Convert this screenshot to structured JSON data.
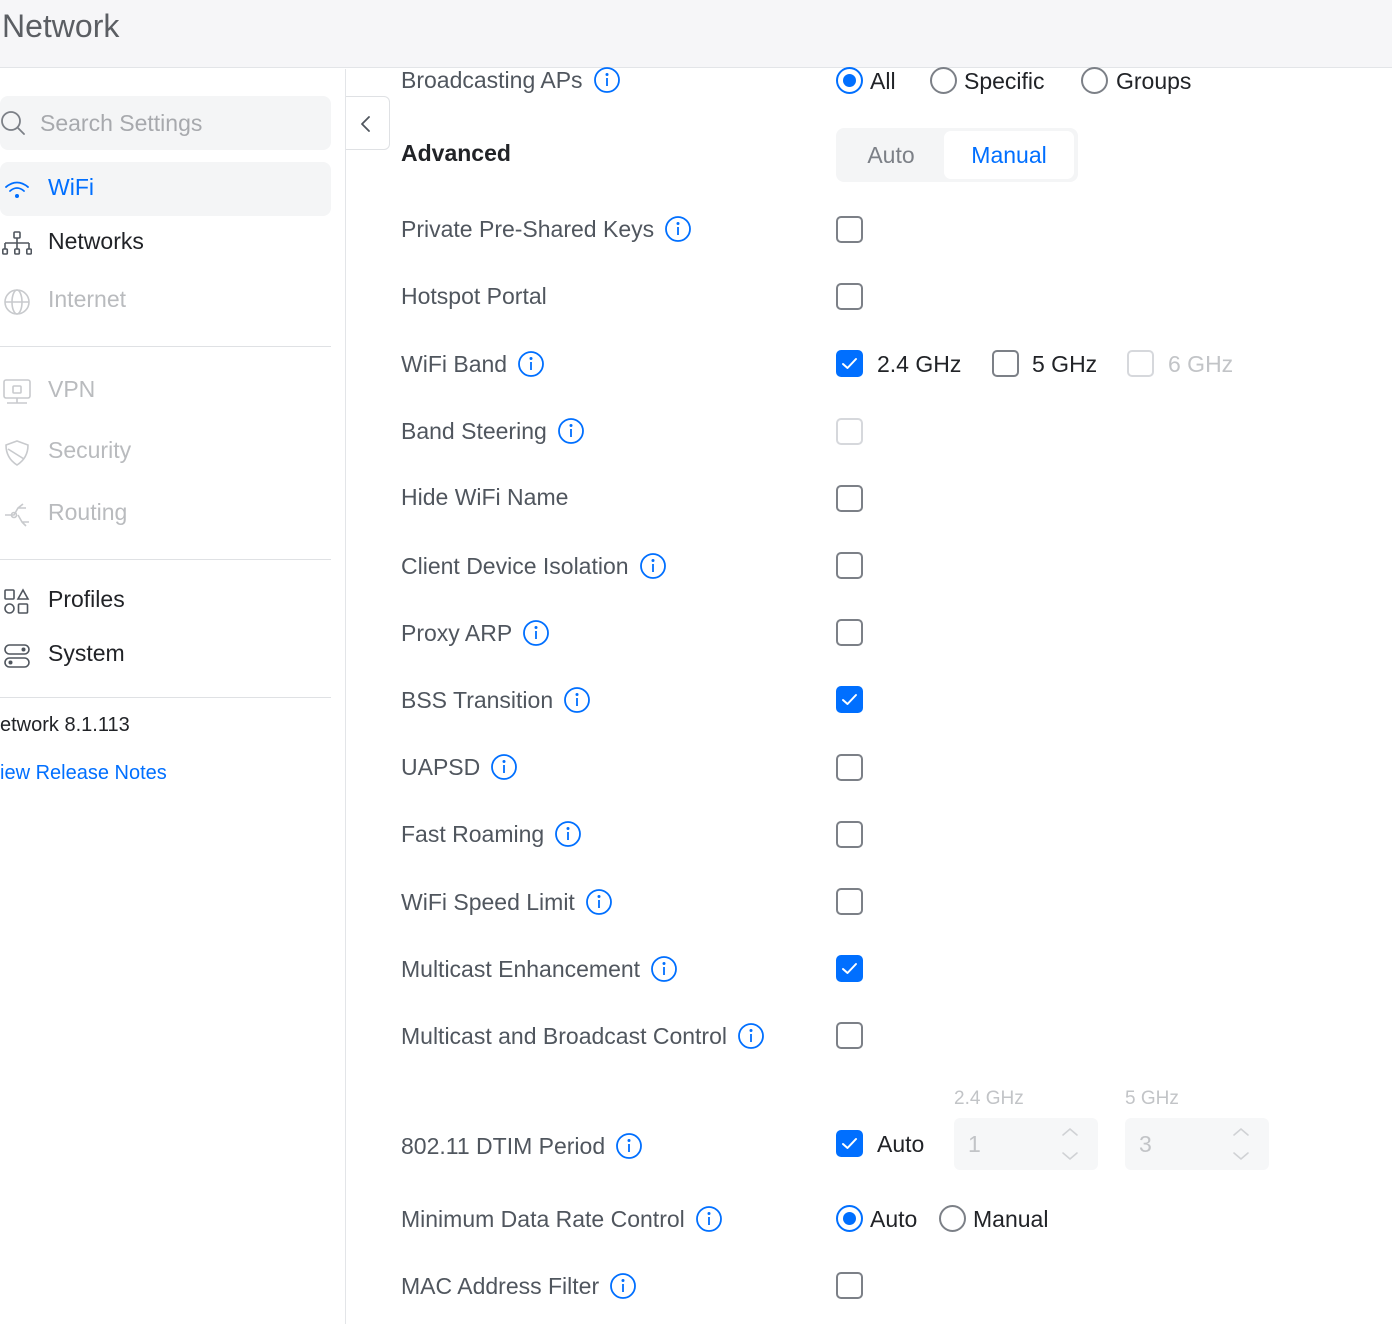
{
  "header": {
    "title": "Network"
  },
  "sidebar": {
    "search_placeholder": "Search Settings",
    "items": [
      {
        "label": "WiFi",
        "icon": "wifi-icon",
        "state": "active"
      },
      {
        "label": "Networks",
        "icon": "network-topology-icon",
        "state": "enabled"
      },
      {
        "label": "Internet",
        "icon": "globe-icon",
        "state": "disabled"
      },
      {
        "label": "VPN",
        "icon": "vpn-icon",
        "state": "disabled"
      },
      {
        "label": "Security",
        "icon": "shield-icon",
        "state": "disabled"
      },
      {
        "label": "Routing",
        "icon": "routing-icon",
        "state": "disabled"
      },
      {
        "label": "Profiles",
        "icon": "profiles-icon",
        "state": "enabled"
      },
      {
        "label": "System",
        "icon": "system-icon",
        "state": "enabled"
      }
    ],
    "version": "etwork 8.1.113",
    "release_notes": "iew Release Notes"
  },
  "settings": {
    "broadcasting_aps": {
      "label": "Broadcasting APs",
      "options": [
        "All",
        "Specific",
        "Groups"
      ],
      "selected": "All"
    },
    "advanced": {
      "label": "Advanced",
      "options": [
        "Auto",
        "Manual"
      ],
      "selected": "Manual"
    },
    "private_psk": {
      "label": "Private Pre-Shared Keys",
      "checked": false
    },
    "hotspot_portal": {
      "label": "Hotspot Portal",
      "checked": false
    },
    "wifi_band": {
      "label": "WiFi Band",
      "options": [
        {
          "label": "2.4 GHz",
          "checked": true,
          "disabled": false
        },
        {
          "label": "5 GHz",
          "checked": false,
          "disabled": false
        },
        {
          "label": "6 GHz",
          "checked": false,
          "disabled": true
        }
      ]
    },
    "band_steering": {
      "label": "Band Steering",
      "checked": false,
      "disabled": true
    },
    "hide_wifi_name": {
      "label": "Hide WiFi Name",
      "checked": false
    },
    "client_isolation": {
      "label": "Client Device Isolation",
      "checked": false
    },
    "proxy_arp": {
      "label": "Proxy ARP",
      "checked": false
    },
    "bss_transition": {
      "label": "BSS Transition",
      "checked": true
    },
    "uapsd": {
      "label": "UAPSD",
      "checked": false
    },
    "fast_roaming": {
      "label": "Fast Roaming",
      "checked": false
    },
    "speed_limit": {
      "label": "WiFi Speed Limit",
      "checked": false
    },
    "multicast_enhancement": {
      "label": "Multicast Enhancement",
      "checked": true
    },
    "multicast_broadcast_control": {
      "label": "Multicast and Broadcast Control",
      "checked": false
    },
    "dtim_period": {
      "label": "802.11 DTIM Period",
      "auto_label": "Auto",
      "auto_checked": true,
      "band_24_label": "2.4 GHz",
      "band_24_value": "1",
      "band_5_label": "5 GHz",
      "band_5_value": "3"
    },
    "min_data_rate": {
      "label": "Minimum Data Rate Control",
      "options": [
        "Auto",
        "Manual"
      ],
      "selected": "Auto"
    },
    "mac_filter": {
      "label": "MAC Address Filter",
      "checked": false
    }
  },
  "colors": {
    "accent": "#006fff",
    "text": "#212327",
    "muted": "#50565e",
    "disabled": "#c2c4c7"
  }
}
